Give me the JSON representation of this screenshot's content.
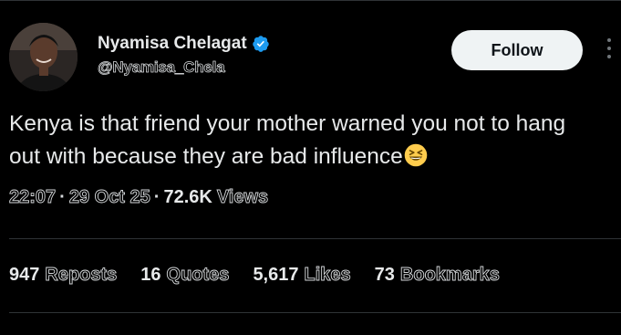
{
  "author": {
    "display_name": "Nyamisa Chelagat",
    "handle": "@Nyamisa_Chela",
    "verified_icon": "verified-badge-icon",
    "avatar": "avatar"
  },
  "follow_button": {
    "label": "Follow"
  },
  "more_icon": "more-vertical-icon",
  "tweet": {
    "text": "Kenya is that friend your mother warned you not to hang out with because they are bad influence",
    "emoji": "😆"
  },
  "meta": {
    "time": "22:07",
    "sep1": "·",
    "date": "29 Oct 25",
    "sep2": "·",
    "views_count": "72.6K",
    "views_label": "Views"
  },
  "stats": [
    {
      "count": "947",
      "label": "Reposts"
    },
    {
      "count": "16",
      "label": "Quotes"
    },
    {
      "count": "5,617",
      "label": "Likes"
    },
    {
      "count": "73",
      "label": "Bookmarks"
    }
  ],
  "colors": {
    "background": "#000000",
    "text": "#e7e9ea",
    "verified": "#1d9bf0",
    "divider": "#2f3336",
    "button_bg": "#eff3f4"
  }
}
